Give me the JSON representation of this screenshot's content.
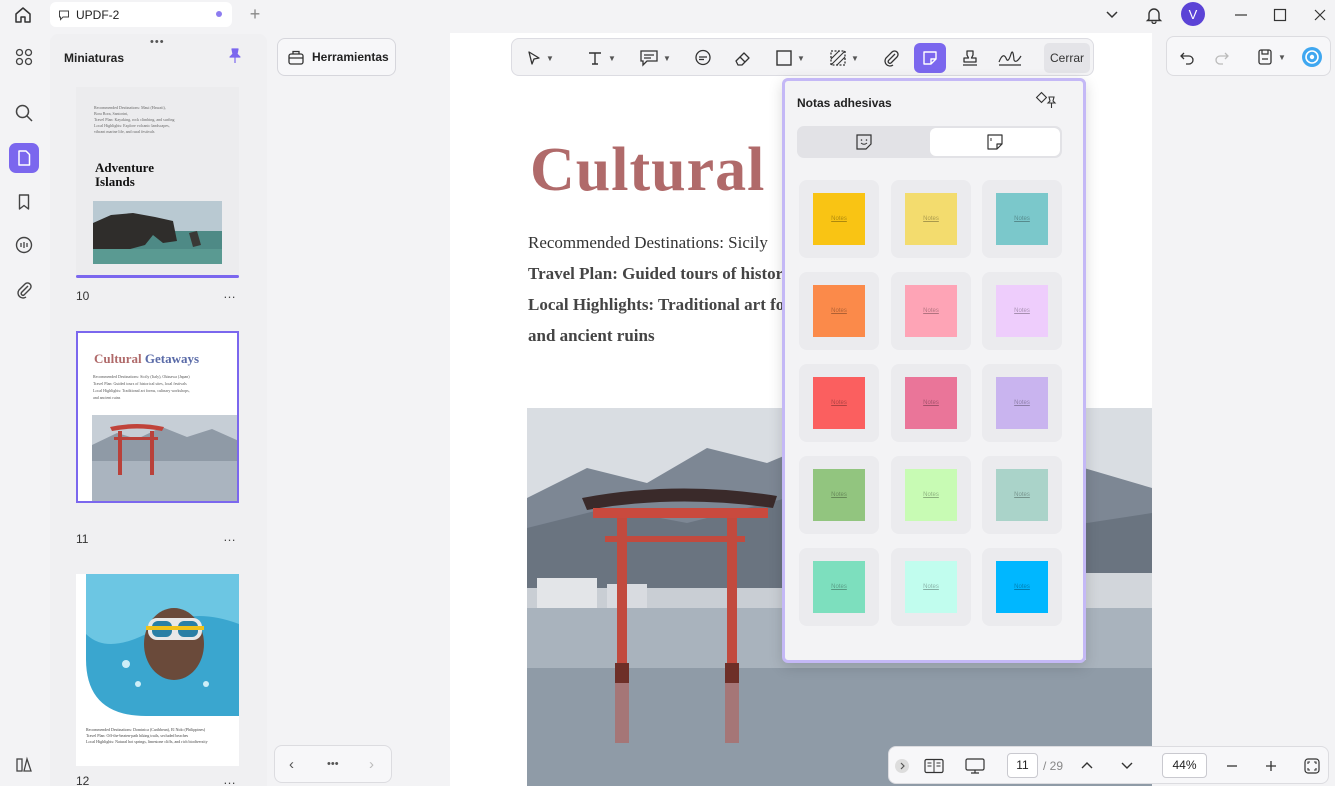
{
  "titlebar": {
    "tab_label": "UPDF-2",
    "avatar_letter": "V"
  },
  "thumbnails": {
    "title": "Miniaturas",
    "handle": "•••",
    "pages": [
      {
        "number": "10",
        "heading": "Adventure Islands",
        "lines": [
          "Recommended Destinations: Maui (Hawaii),",
          "Bora Bora, Santorini,",
          "Travel Plan: Kayaking, rock climbing, and surfing",
          "Local Highlights: Explore volcanic landscapes,",
          "vibrant marine life, and rural festivals"
        ]
      },
      {
        "number": "11",
        "heading_a": "Cultural",
        "heading_b": "Getaways",
        "lines": [
          "Recommended Destinations: Sicily (Italy), Okinawa (Japan)",
          "Travel Plan: Guided tours of historical sites, local festivals",
          "Local Highlights: Traditional art forms, culinary workshops,",
          "and ancient ruins"
        ]
      },
      {
        "number": "12",
        "lines": [
          "Recommended Destinations: Dominica (Caribbean), El Nido (Philippines)",
          "Travel Plan: Off-the-beaten-path hiking trails, secluded beaches",
          "Local Highlights: Natural hot springs, limestone cliffs, and rich biodiversity"
        ]
      }
    ],
    "more": "…"
  },
  "tools": {
    "label": "Herramientas"
  },
  "annotation_toolbar": {
    "close_label": "Cerrar"
  },
  "document": {
    "title": "Cultural",
    "lines": [
      "Recommended Destinations: Sicily",
      "Travel Plan: Guided tours of histor",
      "Local Highlights: Traditional art fo",
      "and ancient ruins"
    ]
  },
  "sticky_notes": {
    "title": "Notas adhesivas",
    "note_text": "Notes",
    "colors": [
      "#f9c414",
      "#f3dc6e",
      "#7bc8cb",
      "#fb8a4a",
      "#fea4b6",
      "#eecdfc",
      "#fb5f5f",
      "#ea7599",
      "#c9b4ef",
      "#92c57f",
      "#c8fbb4",
      "#aad3c9",
      "#7ddfbe",
      "#c1fdee",
      "#00b7ff"
    ]
  },
  "navigation": {
    "current_page": "11",
    "total_pages": "/ 29",
    "zoom": "44%"
  },
  "pager": {
    "dots": "•••"
  }
}
